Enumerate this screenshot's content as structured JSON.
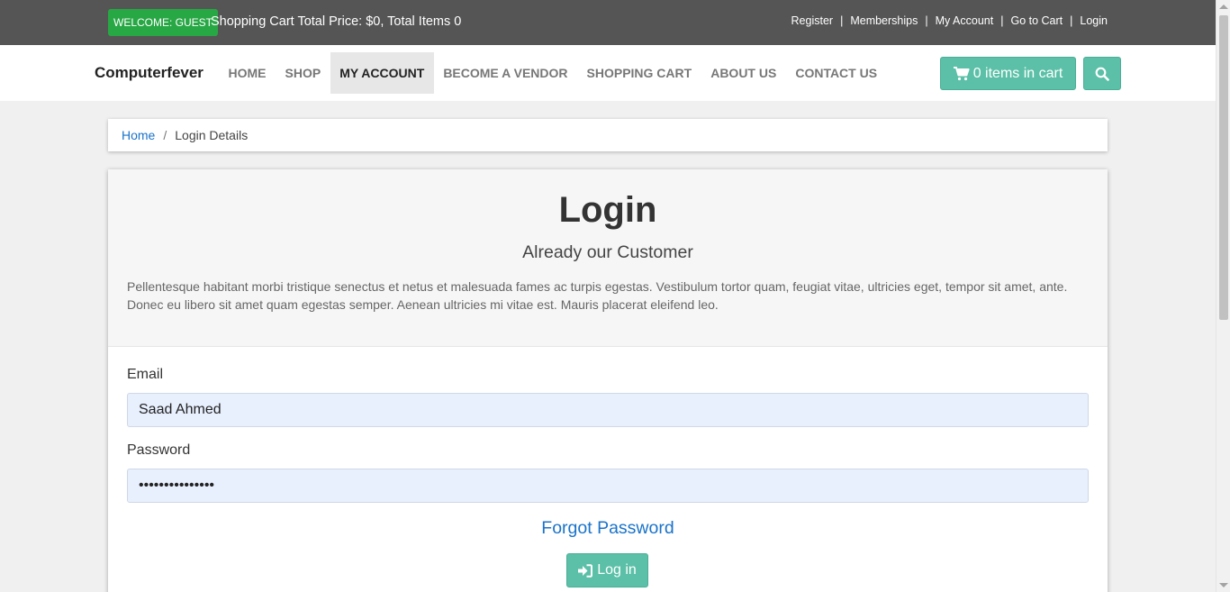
{
  "topbar": {
    "welcome_badge": "WELCOME: GUEST",
    "cart_summary": "Shopping Cart Total Price: $0, Total Items 0",
    "links": [
      "Register",
      "Memberships",
      "My Account",
      "Go to Cart",
      "Login"
    ],
    "separator": "|"
  },
  "navbar": {
    "brand": "Computerfever",
    "items": [
      {
        "label": "HOME"
      },
      {
        "label": "SHOP"
      },
      {
        "label": "MY ACCOUNT"
      },
      {
        "label": "BECOME A VENDOR"
      },
      {
        "label": "SHOPPING CART"
      },
      {
        "label": "ABOUT US"
      },
      {
        "label": "CONTACT US"
      }
    ],
    "active_item": "MY ACCOUNT",
    "cart_button_label": "0 items in cart",
    "cart_icon": "shopping-cart-icon",
    "search_icon": "search-icon"
  },
  "breadcrumb": {
    "home": "Home",
    "separator": "/",
    "current": "Login Details"
  },
  "login": {
    "title": "Login",
    "subtitle": "Already our Customer",
    "description": "Pellentesque habitant morbi tristique senectus et netus et malesuada fames ac turpis egestas. Vestibulum tortor quam, feugiat vitae, ultricies eget, tempor sit amet, ante. Donec eu libero sit amet quam egestas semper. Aenean ultricies mi vitae est. Mauris placerat eleifend leo.",
    "email_label": "Email",
    "email_value": "Saad Ahmed",
    "password_label": "Password",
    "password_value": "•••••••••••••••",
    "forgot_password": "Forgot Password",
    "login_button": "Log in",
    "login_icon": "sign-in-icon"
  },
  "colors": {
    "topbar_bg": "#555555",
    "welcome_badge": "#28a745",
    "accent": "#5bc0a7",
    "link": "#1a73c9",
    "input_bg": "#e8f0fe"
  }
}
